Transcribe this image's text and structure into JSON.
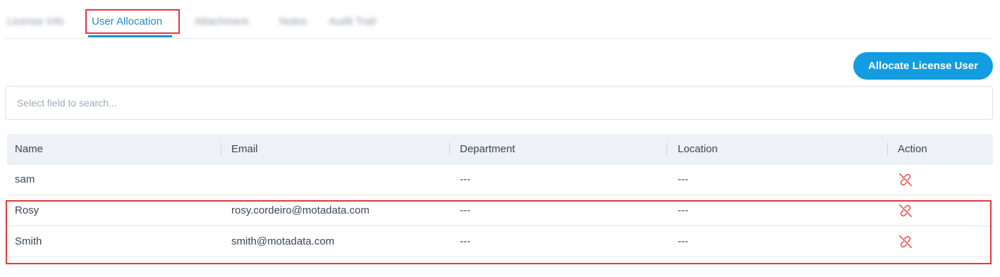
{
  "tabs": [
    {
      "label": "License Info",
      "active": false
    },
    {
      "label": "User Allocation",
      "active": true
    },
    {
      "label": "Attachment",
      "active": false
    },
    {
      "label": "Notes",
      "active": false
    },
    {
      "label": "Audit Trail",
      "active": false
    }
  ],
  "allocate_button": "Allocate License User",
  "search": {
    "placeholder": "Select field to search..."
  },
  "table": {
    "columns": [
      "Name",
      "Email",
      "Department",
      "Location",
      "Action"
    ],
    "rows": [
      {
        "name": "sam",
        "email": "",
        "department": "---",
        "location": "---",
        "action_icon": "unlink-icon"
      },
      {
        "name": "Rosy",
        "email": "rosy.cordeiro@motadata.com",
        "department": "---",
        "location": "---",
        "action_icon": "unlink-icon"
      },
      {
        "name": "Smith",
        "email": "smith@motadata.com",
        "department": "---",
        "location": "---",
        "action_icon": "unlink-icon"
      }
    ]
  },
  "colors": {
    "accent": "#129de0",
    "tab_active": "#1a8fd2",
    "highlight": "#e2373f",
    "unlink_icon": "#e8473f"
  }
}
